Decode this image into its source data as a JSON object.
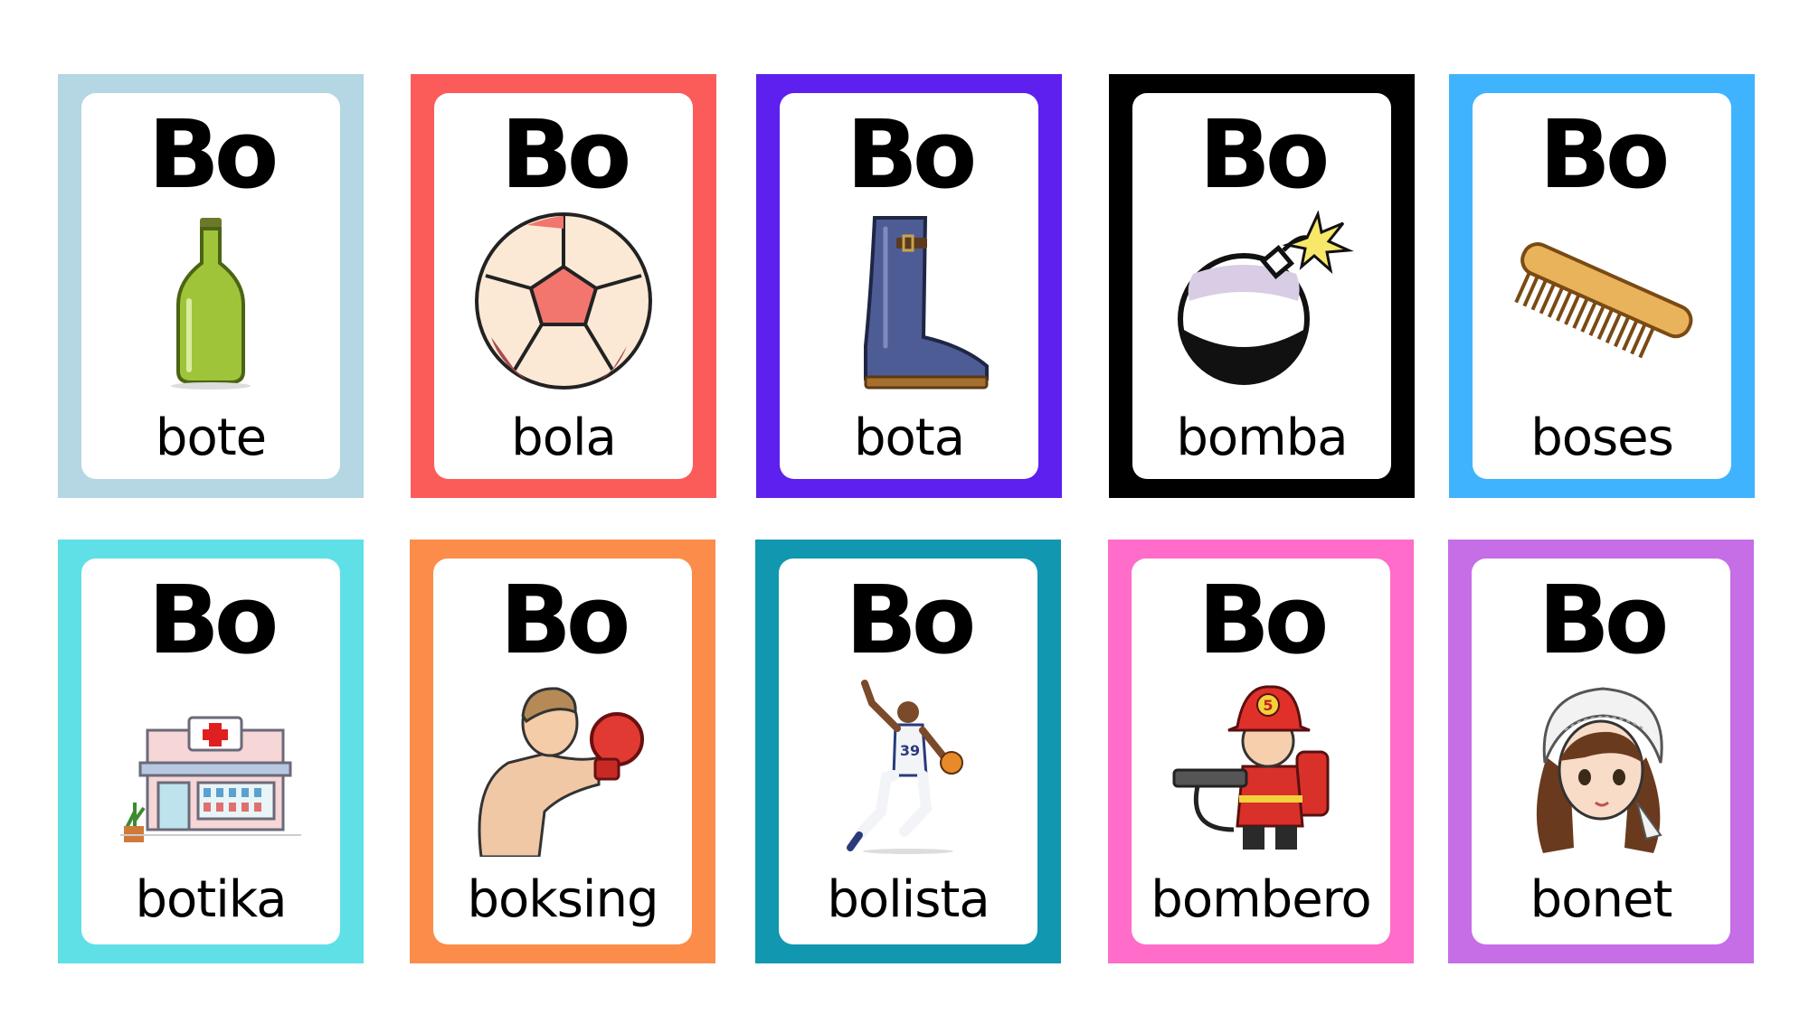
{
  "cards": [
    {
      "syllable": "Bo",
      "word": "bote",
      "border": "#b5d6e3",
      "picture": "bottle-icon"
    },
    {
      "syllable": "Bo",
      "word": "bola",
      "border": "#fb5c5a",
      "picture": "ball-icon"
    },
    {
      "syllable": "Bo",
      "word": "bota",
      "border": "#5e20ef",
      "picture": "boot-icon"
    },
    {
      "syllable": "Bo",
      "word": "bomba",
      "border": "#000000",
      "picture": "bomb-icon"
    },
    {
      "syllable": "Bo",
      "word": "boses",
      "border": "#40b3ff",
      "picture": "comb-icon"
    },
    {
      "syllable": "Bo",
      "word": "botika",
      "border": "#5ee0e6",
      "picture": "pharmacy-icon"
    },
    {
      "syllable": "Bo",
      "word": "boksing",
      "border": "#fb8c4a",
      "picture": "boxer-icon"
    },
    {
      "syllable": "Bo",
      "word": "bolista",
      "border": "#1198b0",
      "picture": "basketball-player-icon"
    },
    {
      "syllable": "Bo",
      "word": "bombero",
      "border": "#ff6cc9",
      "picture": "firefighter-icon"
    },
    {
      "syllable": "Bo",
      "word": "bonet",
      "border": "#c56ee6",
      "picture": "bonnet-girl-icon"
    }
  ]
}
